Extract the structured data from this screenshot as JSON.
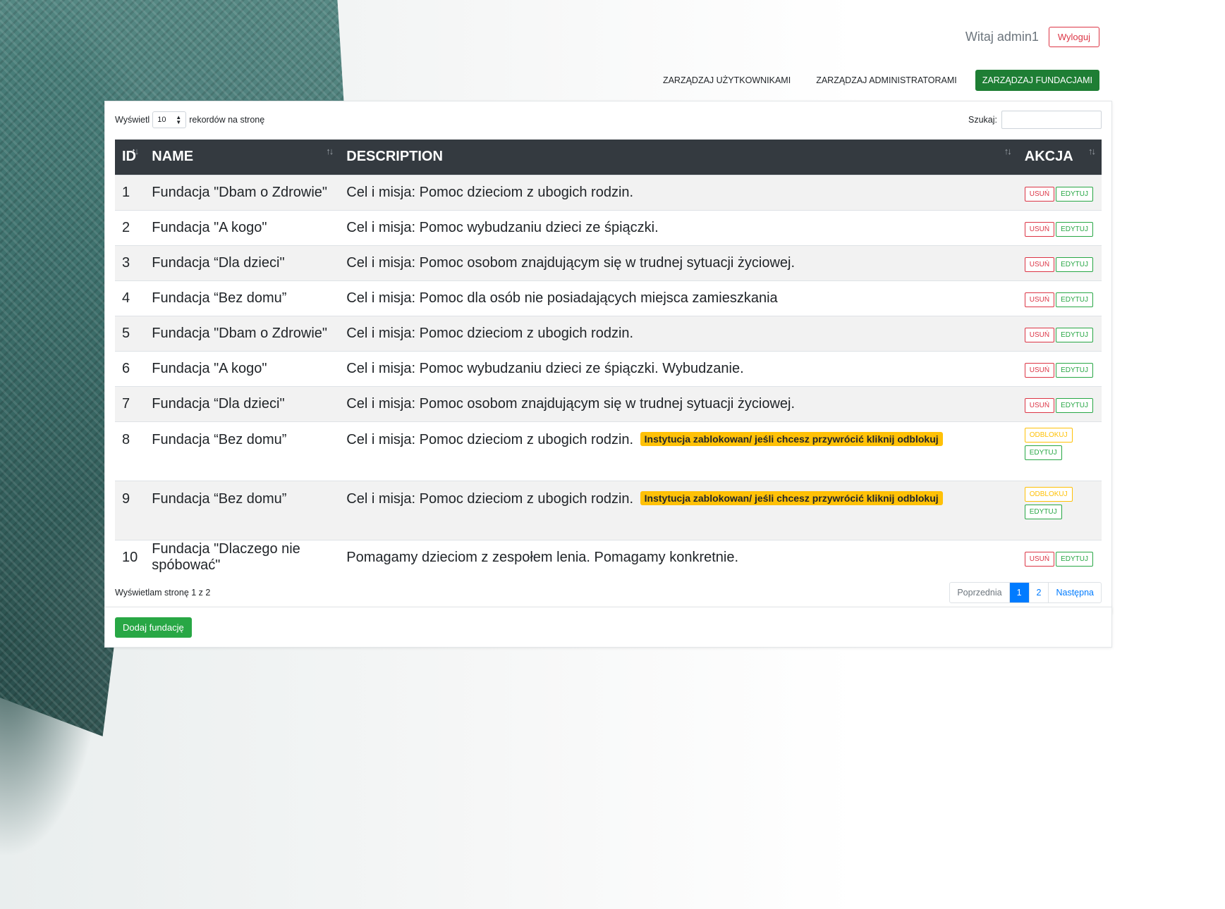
{
  "header": {
    "greeting": "Witaj admin1",
    "logout_label": "Wyloguj"
  },
  "nav": {
    "items": [
      "ZARZĄDZAJ UŻYTKOWNIKAMI",
      "ZARZĄDZAJ ADMINISTRATORAMI",
      "ZARZĄDZAJ FUNDACJAMI"
    ],
    "active": "ZARZĄDZAJ FUNDACJAMI"
  },
  "controls": {
    "show_label": "Wyświetl",
    "page_length": "10",
    "records_label": "rekordów na stronę",
    "search_label": "Szukaj:",
    "search_value": ""
  },
  "table": {
    "columns": [
      "ID",
      "NAME",
      "DESCRIPTION",
      "AKCJA"
    ],
    "rows": [
      {
        "id": "1",
        "name": "Fundacja \"Dbam o Zdrowie\"",
        "description": "Cel i misja: Pomoc dzieciom z ubogich rodzin.",
        "blocked": false
      },
      {
        "id": "2",
        "name": "Fundacja \"A kogo\"",
        "description": "Cel i misja: Pomoc wybudzaniu dzieci ze śpiączki.",
        "blocked": false
      },
      {
        "id": "3",
        "name": "Fundacja “Dla dzieci\"",
        "description": "Cel i misja: Pomoc osobom znajdującym się w trudnej sytuacji życiowej.",
        "blocked": false
      },
      {
        "id": "4",
        "name": "Fundacja “Bez domu”",
        "description": "Cel i misja: Pomoc dla osób nie posiadających miejsca zamieszkania",
        "blocked": false
      },
      {
        "id": "5",
        "name": "Fundacja \"Dbam o Zdrowie\"",
        "description": "Cel i misja: Pomoc dzieciom z ubogich rodzin.",
        "blocked": false
      },
      {
        "id": "6",
        "name": "Fundacja \"A kogo\"",
        "description": "Cel i misja: Pomoc wybudzaniu dzieci ze śpiączki. Wybudzanie.",
        "blocked": false
      },
      {
        "id": "7",
        "name": "Fundacja “Dla dzieci\"",
        "description": "Cel i misja: Pomoc osobom znajdującym się w trudnej sytuacji życiowej.",
        "blocked": false
      },
      {
        "id": "8",
        "name": "Fundacja “Bez domu”",
        "description": "Cel i misja: Pomoc dzieciom z ubogich rodzin.",
        "blocked": true
      },
      {
        "id": "9",
        "name": "Fundacja “Bez domu”",
        "description": "Cel i misja: Pomoc dzieciom z ubogich rodzin.",
        "blocked": true
      },
      {
        "id": "10",
        "name": "Fundacja \"Dlaczego nie spóbować\"",
        "description": "Pomagamy dzieciom z zespołem lenia. Pomagamy konkretnie.",
        "blocked": false
      }
    ],
    "blocked_badge": "Instytucja zablokowan/ jeśli chcesz przywrócić kliknij odblokuj",
    "delete_label": "USUŃ",
    "edit_label": "EDYTUJ",
    "unblock_label": "ODBLOKUJ"
  },
  "footer": {
    "info": "Wyświetlam stronę 1 z 2",
    "prev": "Poprzednia",
    "pages": [
      "1",
      "2"
    ],
    "current_page": "1",
    "next": "Następna"
  },
  "add_button": "Dodaj fundację",
  "colors": {
    "header_bg": "#343a40",
    "active_nav": "#1e7e34",
    "danger": "#dc3545",
    "success": "#28a745",
    "warning": "#ffc107",
    "primary": "#007bff"
  }
}
